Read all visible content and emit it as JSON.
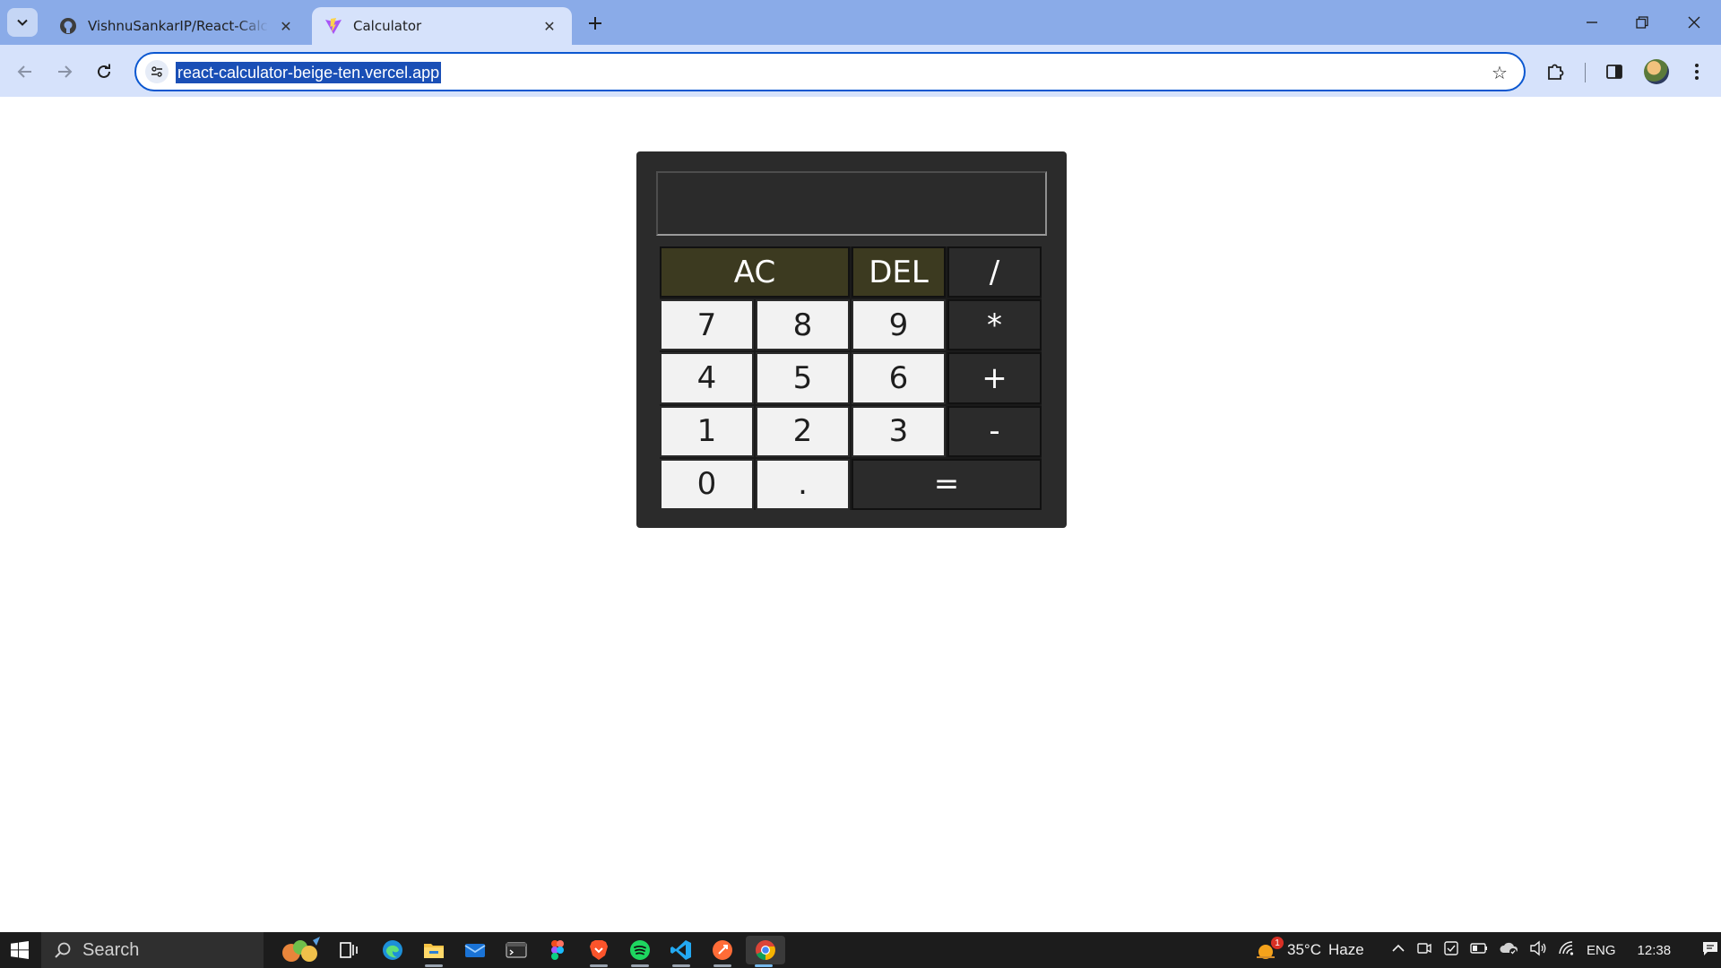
{
  "browser": {
    "tabs": [
      {
        "title": "VishnuSankarIP/React-Calculator",
        "favicon": "github-icon",
        "active": false
      },
      {
        "title": "Calculator",
        "favicon": "vite-icon",
        "active": true
      }
    ],
    "url": "react-calculator-beige-ten.vercel.app",
    "accent_color": "#8aabe8",
    "toolbar_color": "#d6e2fb"
  },
  "calculator": {
    "display_value": "",
    "keys": [
      {
        "label": "AC",
        "kind": "fn",
        "span": 2
      },
      {
        "label": "DEL",
        "kind": "fn",
        "span": 1
      },
      {
        "label": "/",
        "kind": "op",
        "span": 1
      },
      {
        "label": "7",
        "kind": "num",
        "span": 1
      },
      {
        "label": "8",
        "kind": "num",
        "span": 1
      },
      {
        "label": "9",
        "kind": "num",
        "span": 1
      },
      {
        "label": "*",
        "kind": "op",
        "span": 1
      },
      {
        "label": "4",
        "kind": "num",
        "span": 1
      },
      {
        "label": "5",
        "kind": "num",
        "span": 1
      },
      {
        "label": "6",
        "kind": "num",
        "span": 1
      },
      {
        "label": "+",
        "kind": "op",
        "span": 1
      },
      {
        "label": "1",
        "kind": "num",
        "span": 1
      },
      {
        "label": "2",
        "kind": "num",
        "span": 1
      },
      {
        "label": "3",
        "kind": "num",
        "span": 1
      },
      {
        "label": "-",
        "kind": "op",
        "span": 1
      },
      {
        "label": "0",
        "kind": "num",
        "span": 1
      },
      {
        "label": ".",
        "kind": "num",
        "span": 1
      },
      {
        "label": "=",
        "kind": "op",
        "span": 2
      }
    ],
    "colors": {
      "body": "#2b2b2b",
      "number_key": "#f2f2f2",
      "function_key": "#3c3a20",
      "operator_key": "#2b2b2b"
    }
  },
  "taskbar": {
    "search_placeholder": "Search",
    "apps": [
      "widgets-icon",
      "task-view-icon",
      "edge-icon",
      "file-explorer-icon",
      "mail-icon",
      "terminal-icon",
      "figma-icon",
      "brave-icon",
      "spotify-icon",
      "vscode-icon",
      "postman-icon",
      "chrome-icon"
    ],
    "weather": {
      "temp": "35°C",
      "condition": "Haze",
      "alert_count": "1"
    },
    "language": "ENG",
    "time": "12:38"
  }
}
